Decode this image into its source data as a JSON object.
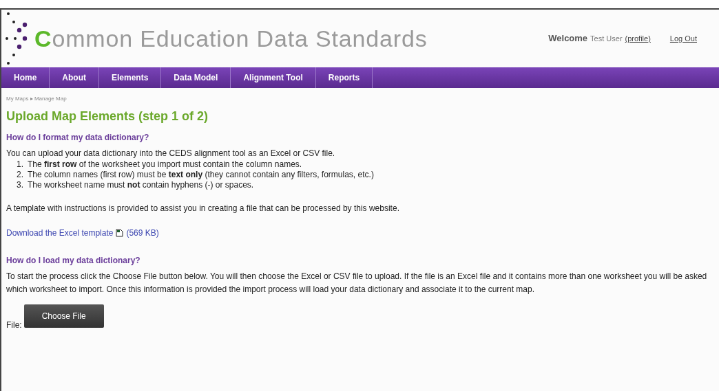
{
  "header": {
    "logo_text": "Common Education Data Standards",
    "welcome": "Welcome",
    "user": "Test User",
    "profile_link": "(profile)",
    "logout_link": "Log Out"
  },
  "nav": [
    "Home",
    "About",
    "Elements",
    "Data Model",
    "Alignment Tool",
    "Reports"
  ],
  "breadcrumb": "My Maps ▸ Manage Map",
  "title": "Upload Map Elements (step 1 of 2)",
  "format_section": {
    "heading": "How do I format my data dictionary?",
    "intro": "You can upload your data dictionary into the CEDS alignment tool as an Excel or CSV file.",
    "steps": [
      {
        "number": "1.",
        "text": "The **first row** of the worksheet you import must contain the column names."
      },
      {
        "number": "2.",
        "text": "The column names (first row) must be **text only** (they cannot contain any filters, formulas, etc.)"
      },
      {
        "number": "3.",
        "text": "The worksheet name must **not** contain hyphens (-) or spaces."
      }
    ],
    "template_note": "A template with instructions is provided to assist you in creating a file that can be processed by this website.",
    "download_link": "Download the Excel template",
    "download_size": "(569 KB)"
  },
  "load_section": {
    "heading": "How do I load my data dictionary?",
    "text": "To start the process click the Choose File button below. You will then choose the Excel or CSV file to upload. If the file is an Excel file and it contains more than one worksheet you will be asked which worksheet to import. Once this information is provided the import process will load your data dictionary and associate it to the current map.",
    "file_label": "File:",
    "choose_button": "Choose File"
  }
}
